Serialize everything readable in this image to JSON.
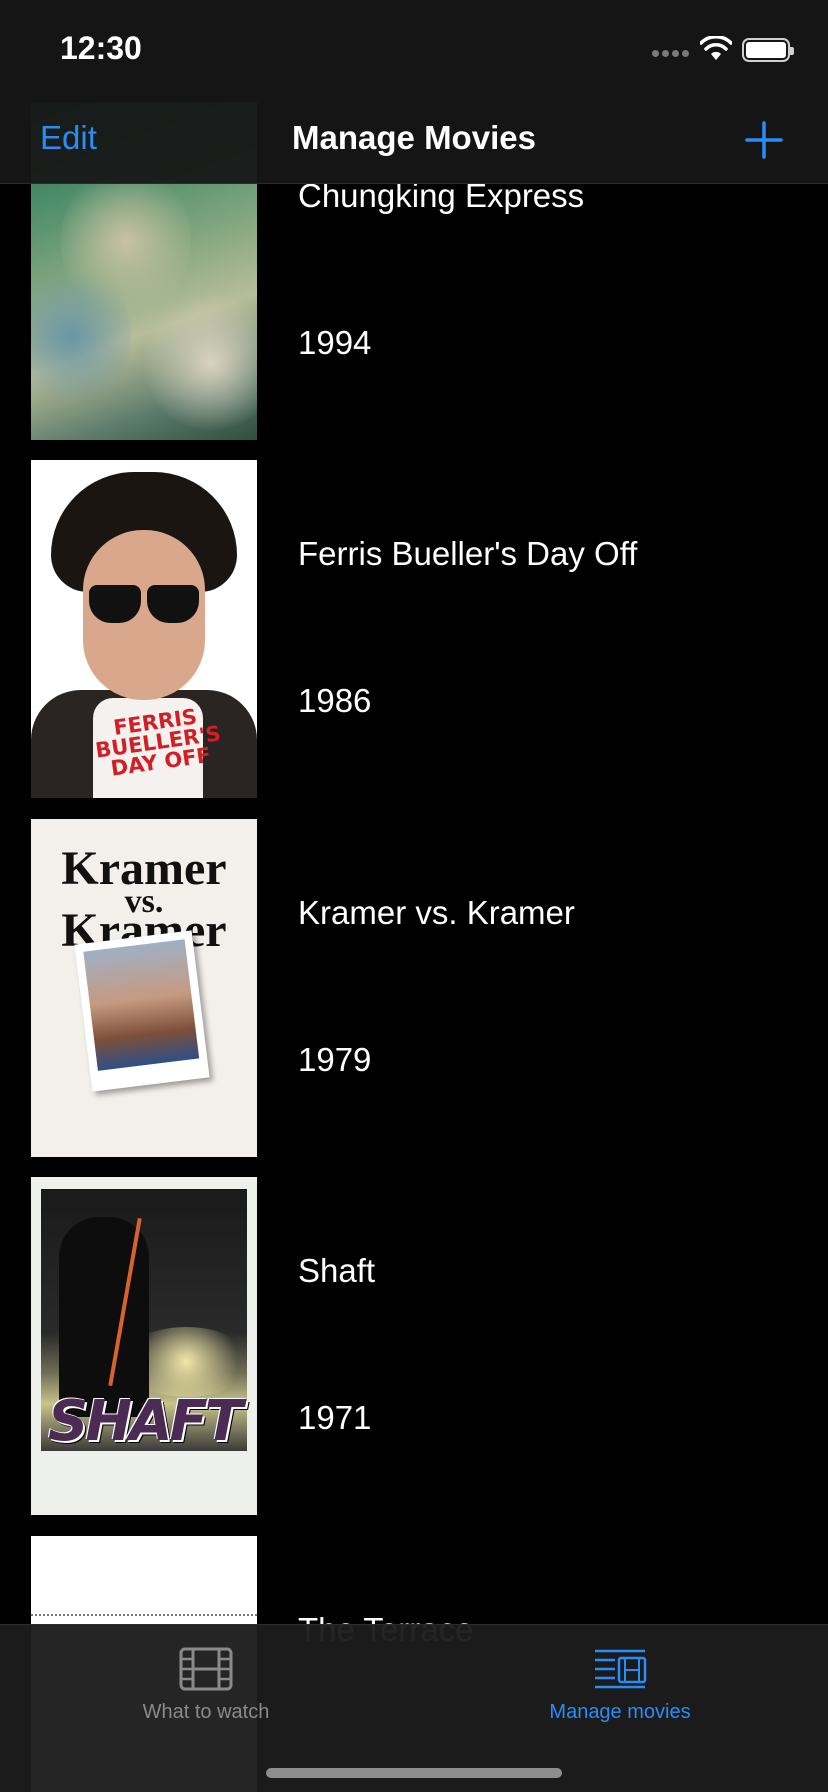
{
  "status_bar": {
    "time": "12:30"
  },
  "nav": {
    "edit_label": "Edit",
    "title": "Manage Movies",
    "add_icon": "plus-icon"
  },
  "movies": [
    {
      "title": "Chungking Express",
      "year": "1994"
    },
    {
      "title": "Ferris Bueller's Day Off",
      "year": "1986",
      "poster_text": "FERRIS BUELLER'S DAY OFF"
    },
    {
      "title": "Kramer vs. Kramer",
      "year": "1979",
      "poster_text_1": "Kramer",
      "poster_text_2": "vs.",
      "poster_text_3": "Kramer"
    },
    {
      "title": "Shaft",
      "year": "1971",
      "poster_text": "SHAFT"
    },
    {
      "title": "The Terrace",
      "year": ""
    }
  ],
  "tabs": [
    {
      "label": "What to watch",
      "icon": "film-icon",
      "selected": false
    },
    {
      "label": "Manage movies",
      "icon": "film-list-icon",
      "selected": true
    }
  ],
  "colors": {
    "accent": "#2a8cf5",
    "background": "#000000",
    "inactive": "#8a8a8a"
  }
}
